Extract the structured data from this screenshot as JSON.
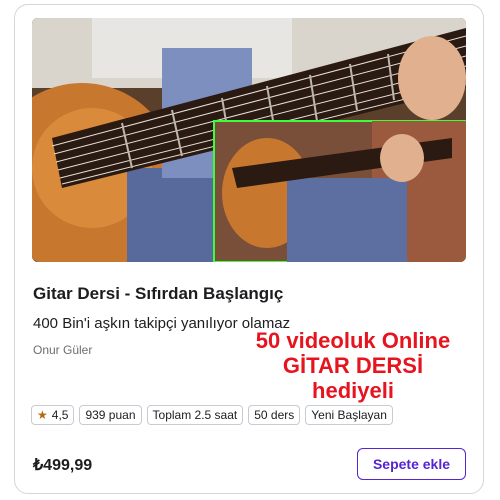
{
  "course": {
    "title": "Gitar Dersi - Sıfırdan Başlangıç",
    "subtitle": "400 Bin'i aşkın takipçi yanılıyor olamaz",
    "author": "Onur Güler",
    "promo_lines": [
      "50 videoluk Online",
      "GİTAR DERSİ",
      "hediyeli"
    ],
    "rating": "4,5",
    "rating_icon": "star-icon",
    "badges": {
      "reviews": "939 puan",
      "duration": "Toplam 2.5 saat",
      "lectures": "50 ders",
      "level": "Yeni Başlayan"
    },
    "price": "₺499,99",
    "cart_button": "Sepete ekle"
  },
  "colors": {
    "accent": "#5624d0",
    "promo_red": "#e6141e",
    "star": "#b4690e",
    "inset_frame": "#3cff3c"
  }
}
